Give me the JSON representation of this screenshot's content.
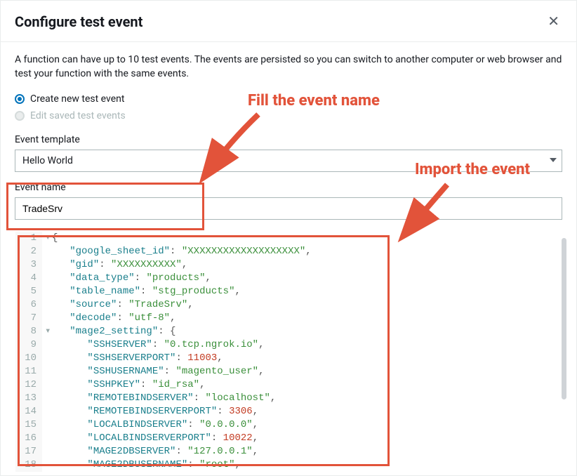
{
  "header": {
    "title": "Configure test event"
  },
  "description": "A function can have up to 10 test events. The events are persisted so you can switch to another computer or web browser and test your function with the same events.",
  "radios": {
    "create": "Create new test event",
    "edit": "Edit saved test events"
  },
  "template": {
    "label": "Event template",
    "value": "Hello World"
  },
  "eventName": {
    "label": "Event name",
    "value": "TradeSrv"
  },
  "annotations": {
    "fill": "Fill the event name",
    "import": "Import the event"
  },
  "code": {
    "lines": [
      [
        {
          "t": "punc",
          "v": "{"
        }
      ],
      [
        {
          "t": "pad",
          "v": "   "
        },
        {
          "t": "key",
          "v": "\"google_sheet_id\""
        },
        {
          "t": "punc",
          "v": ": "
        },
        {
          "t": "str",
          "v": "\"XXXXXXXXXXXXXXXXXXX\""
        },
        {
          "t": "punc",
          "v": ","
        }
      ],
      [
        {
          "t": "pad",
          "v": "   "
        },
        {
          "t": "key",
          "v": "\"gid\""
        },
        {
          "t": "punc",
          "v": ": "
        },
        {
          "t": "str",
          "v": "\"XXXXXXXXXX\""
        },
        {
          "t": "punc",
          "v": ","
        }
      ],
      [
        {
          "t": "pad",
          "v": "   "
        },
        {
          "t": "key",
          "v": "\"data_type\""
        },
        {
          "t": "punc",
          "v": ": "
        },
        {
          "t": "str",
          "v": "\"products\""
        },
        {
          "t": "punc",
          "v": ","
        }
      ],
      [
        {
          "t": "pad",
          "v": "   "
        },
        {
          "t": "key",
          "v": "\"table_name\""
        },
        {
          "t": "punc",
          "v": ": "
        },
        {
          "t": "str",
          "v": "\"stg_products\""
        },
        {
          "t": "punc",
          "v": ","
        }
      ],
      [
        {
          "t": "pad",
          "v": "   "
        },
        {
          "t": "key",
          "v": "\"source\""
        },
        {
          "t": "punc",
          "v": ": "
        },
        {
          "t": "str",
          "v": "\"TradeSrv\""
        },
        {
          "t": "punc",
          "v": ","
        }
      ],
      [
        {
          "t": "pad",
          "v": "   "
        },
        {
          "t": "key",
          "v": "\"decode\""
        },
        {
          "t": "punc",
          "v": ": "
        },
        {
          "t": "str",
          "v": "\"utf-8\""
        },
        {
          "t": "punc",
          "v": ","
        }
      ],
      [
        {
          "t": "pad",
          "v": "   "
        },
        {
          "t": "key",
          "v": "\"mage2_setting\""
        },
        {
          "t": "punc",
          "v": ": {"
        }
      ],
      [
        {
          "t": "pad",
          "v": "      "
        },
        {
          "t": "key",
          "v": "\"SSHSERVER\""
        },
        {
          "t": "punc",
          "v": ": "
        },
        {
          "t": "str",
          "v": "\"0.tcp.ngrok.io\""
        },
        {
          "t": "punc",
          "v": ","
        }
      ],
      [
        {
          "t": "pad",
          "v": "      "
        },
        {
          "t": "key",
          "v": "\"SSHSERVERPORT\""
        },
        {
          "t": "punc",
          "v": ": "
        },
        {
          "t": "num",
          "v": "11003"
        },
        {
          "t": "punc",
          "v": ","
        }
      ],
      [
        {
          "t": "pad",
          "v": "      "
        },
        {
          "t": "key",
          "v": "\"SSHUSERNAME\""
        },
        {
          "t": "punc",
          "v": ": "
        },
        {
          "t": "str",
          "v": "\"magento_user\""
        },
        {
          "t": "punc",
          "v": ","
        }
      ],
      [
        {
          "t": "pad",
          "v": "      "
        },
        {
          "t": "key",
          "v": "\"SSHPKEY\""
        },
        {
          "t": "punc",
          "v": ": "
        },
        {
          "t": "str",
          "v": "\"id_rsa\""
        },
        {
          "t": "punc",
          "v": ","
        }
      ],
      [
        {
          "t": "pad",
          "v": "      "
        },
        {
          "t": "key",
          "v": "\"REMOTEBINDSERVER\""
        },
        {
          "t": "punc",
          "v": ": "
        },
        {
          "t": "str",
          "v": "\"localhost\""
        },
        {
          "t": "punc",
          "v": ","
        }
      ],
      [
        {
          "t": "pad",
          "v": "      "
        },
        {
          "t": "key",
          "v": "\"REMOTEBINDSERVERPORT\""
        },
        {
          "t": "punc",
          "v": ": "
        },
        {
          "t": "num",
          "v": "3306"
        },
        {
          "t": "punc",
          "v": ","
        }
      ],
      [
        {
          "t": "pad",
          "v": "      "
        },
        {
          "t": "key",
          "v": "\"LOCALBINDSERVER\""
        },
        {
          "t": "punc",
          "v": ": "
        },
        {
          "t": "str",
          "v": "\"0.0.0.0\""
        },
        {
          "t": "punc",
          "v": ","
        }
      ],
      [
        {
          "t": "pad",
          "v": "      "
        },
        {
          "t": "key",
          "v": "\"LOCALBINDSERVERPORT\""
        },
        {
          "t": "punc",
          "v": ": "
        },
        {
          "t": "num",
          "v": "10022"
        },
        {
          "t": "punc",
          "v": ","
        }
      ],
      [
        {
          "t": "pad",
          "v": "      "
        },
        {
          "t": "key",
          "v": "\"MAGE2DBSERVER\""
        },
        {
          "t": "punc",
          "v": ": "
        },
        {
          "t": "str",
          "v": "\"127.0.0.1\""
        },
        {
          "t": "punc",
          "v": ","
        }
      ],
      [
        {
          "t": "pad",
          "v": "      "
        },
        {
          "t": "key",
          "v": "\"MAGE2DBUSERNAME\""
        },
        {
          "t": "punc",
          "v": ": "
        },
        {
          "t": "str",
          "v": "\"root\""
        },
        {
          "t": "punc",
          "v": ","
        }
      ]
    ]
  }
}
